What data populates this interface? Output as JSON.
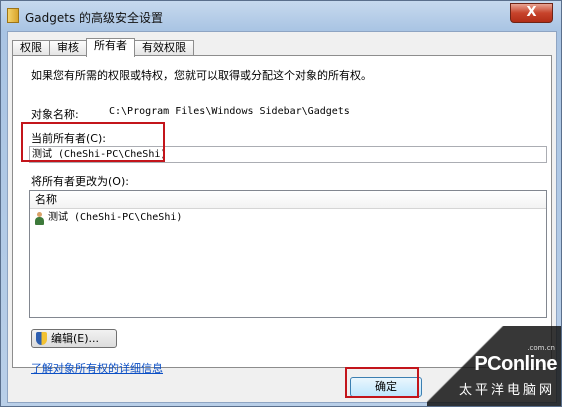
{
  "window": {
    "title": "Gadgets 的高级安全设置",
    "close_glyph": "X"
  },
  "tabs": [
    {
      "label": "权限"
    },
    {
      "label": "审核"
    },
    {
      "label": "所有者"
    },
    {
      "label": "有效权限"
    }
  ],
  "panel": {
    "description": "如果您有所需的权限或特权，您就可以取得或分配这个对象的所有权。",
    "object_name_label": "对象名称:",
    "object_name_value": "C:\\Program Files\\Windows Sidebar\\Gadgets",
    "current_owner_label": "当前所有者(C):",
    "current_owner_value": "测试 (CheShi-PC\\CheShi)",
    "change_to_label": "将所有者更改为(O):",
    "list_header": "名称",
    "list_items": [
      {
        "name": "测试 (CheShi-PC\\CheShi)"
      }
    ],
    "edit_button": "编辑(E)...",
    "details_link": "了解对象所有权的详细信息"
  },
  "footer": {
    "ok_button": "确定"
  },
  "watermark": {
    "logo": "PConline",
    "domain": ".com.cn",
    "sub": "太平洋电脑网"
  },
  "colors": {
    "highlight": "#c3151b",
    "link": "#0b4fc5"
  }
}
